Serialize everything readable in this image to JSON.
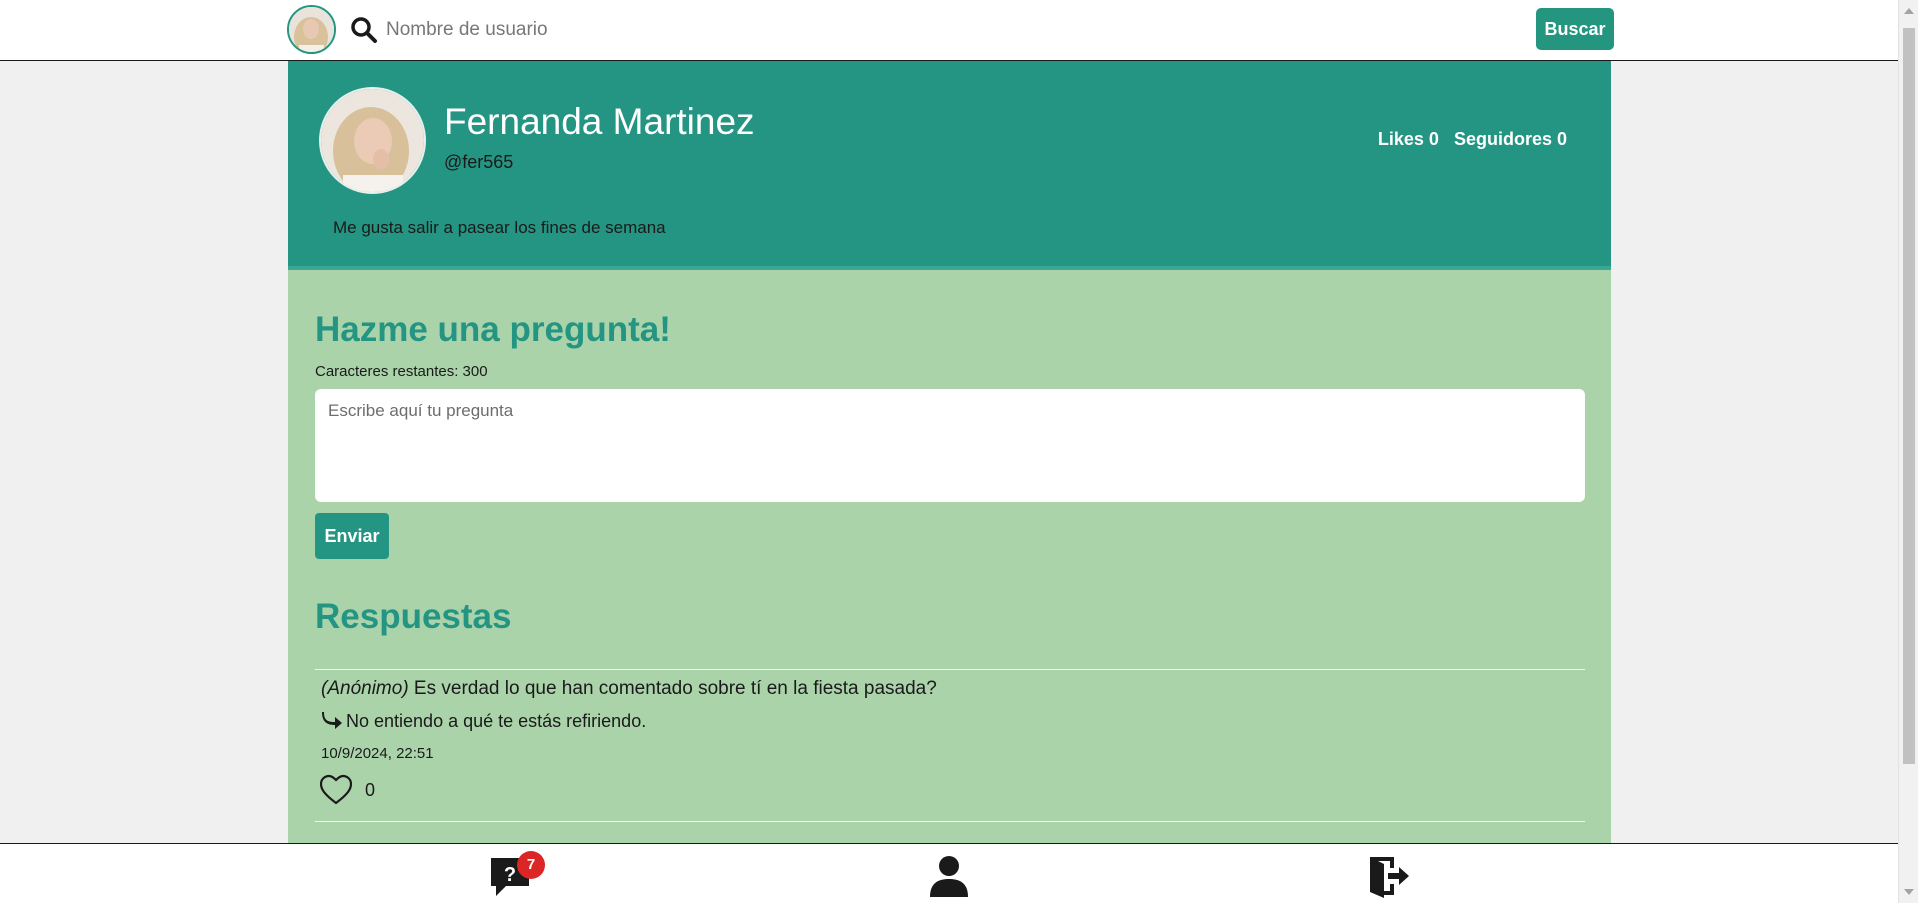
{
  "topbar": {
    "search_placeholder": "Nombre de usuario",
    "search_button": "Buscar"
  },
  "profile": {
    "name": "Fernanda Martinez",
    "username": "@fer565",
    "likes_label": "Likes 0",
    "followers_label": "Seguidores 0",
    "bio": "Me gusta salir a pasear los fines de semana"
  },
  "ask": {
    "title": "Hazme una pregunta!",
    "chars_left": "Caracteres restantes: 300",
    "placeholder": "Escribe aquí tu pregunta",
    "send_button": "Enviar"
  },
  "answers": {
    "title": "Respuestas",
    "items": [
      {
        "author": "(Anónimo)",
        "question": " Es verdad lo que han comentado sobre tí en la fiesta pasada?",
        "reply": "No entiendo a qué te estás refiriendo.",
        "date": "10/9/2024, 22:51",
        "likes": "0"
      }
    ]
  },
  "bottombar": {
    "questions_badge": "7"
  },
  "colors": {
    "brand": "#249583",
    "section_bg": "#aad3aa",
    "badge": "#dc2626"
  },
  "icons": [
    "search-icon",
    "reply-arrow-icon",
    "heart-icon",
    "question-chat-icon",
    "user-icon",
    "logout-icon"
  ]
}
